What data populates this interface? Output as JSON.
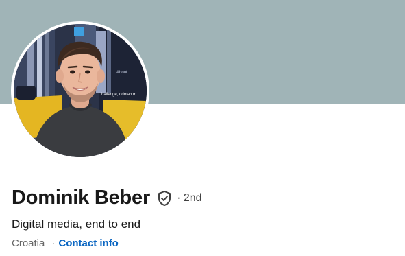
{
  "profile": {
    "name": "Dominik Beber",
    "degree": "· 2nd",
    "headline": "Digital media, end to end",
    "location": "Croatia",
    "separator": "·",
    "contact_info": "Contact info",
    "verified_icon": "shield-check-icon"
  },
  "avatar_bg_text": {
    "line1": "About",
    "line2": "hallenge, odmah m"
  },
  "colors": {
    "cover": "#a0b4b7",
    "link": "#0a66c2",
    "name": "#191919",
    "muted": "#666666"
  }
}
